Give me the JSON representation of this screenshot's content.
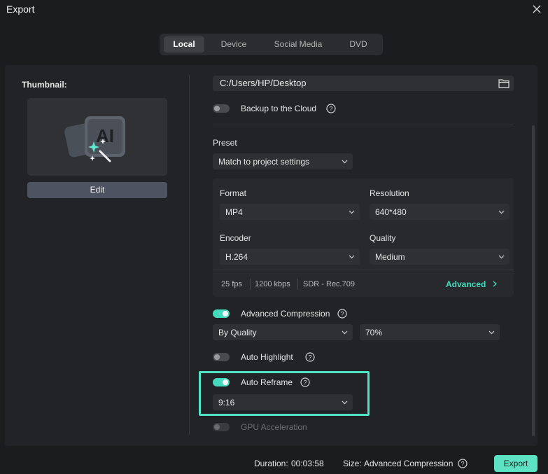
{
  "window": {
    "title": "Export"
  },
  "tabs": [
    {
      "label": "Local",
      "active": true
    },
    {
      "label": "Device",
      "active": false
    },
    {
      "label": "Social Media",
      "active": false
    },
    {
      "label": "DVD",
      "active": false
    }
  ],
  "thumbnail": {
    "label": "Thumbnail:",
    "image_text": "AI",
    "edit_label": "Edit"
  },
  "output": {
    "path": "C:/Users/HP/Desktop",
    "backup_label": "Backup to the Cloud",
    "backup_on": false
  },
  "preset": {
    "label": "Preset",
    "value": "Match to project settings"
  },
  "format": {
    "format_label": "Format",
    "format_value": "MP4",
    "resolution_label": "Resolution",
    "resolution_value": "640*480",
    "encoder_label": "Encoder",
    "encoder_value": "H.264",
    "quality_label": "Quality",
    "quality_value": "Medium",
    "fps": "25 fps",
    "bitrate": "1200 kbps",
    "color_space": "SDR - Rec.709",
    "advanced_label": "Advanced"
  },
  "compression": {
    "label": "Advanced Compression",
    "on": true,
    "mode_value": "By Quality",
    "percent_value": "70%"
  },
  "auto_highlight": {
    "label": "Auto Highlight",
    "on": false
  },
  "auto_reframe": {
    "label": "Auto Reframe",
    "on": true,
    "ratio_value": "9:16"
  },
  "gpu": {
    "label": "GPU Acceleration",
    "on": false,
    "disabled": true
  },
  "footer": {
    "duration_label": "Duration:",
    "duration_value": "00:03:58",
    "size_label": "Size:",
    "size_value": "Advanced Compression",
    "export_label": "Export"
  },
  "colors": {
    "accent": "#45dbbf",
    "highlight_border": "#4fe4c4",
    "background": "#1b1c1e",
    "panel": "#222326"
  }
}
